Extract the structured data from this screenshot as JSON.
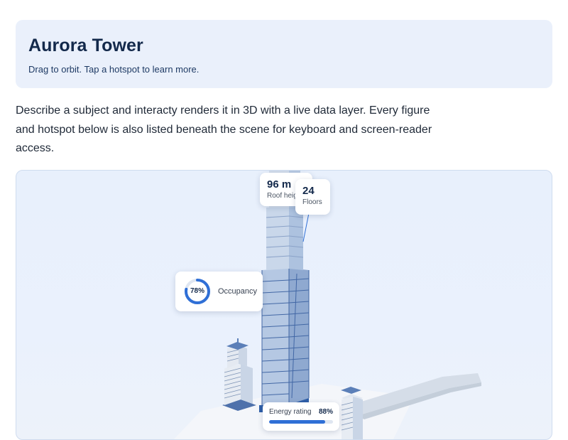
{
  "header": {
    "title": "Aurora Tower",
    "subtitle": "Drag to orbit. Tap a hotspot to learn more."
  },
  "description": "Describe a subject and interacty renders it in 3D with a live data layer. Every figure and hotspot below is also listed beneath the scene for keyboard and screen-reader access.",
  "hotspots": {
    "roof_height": {
      "value": "96 m",
      "label": "Roof height"
    },
    "floors": {
      "value": "24",
      "label": "Floors"
    },
    "occupancy": {
      "value": "78%",
      "label": "Occupancy",
      "fraction": 0.78
    },
    "energy": {
      "label": "Energy rating",
      "value": "88%",
      "fraction": 0.88
    }
  },
  "colors": {
    "accent": "#2f6fd6",
    "header_bg": "#eaf0fb",
    "title": "#13294b",
    "tower_glass": "#a9c0e0",
    "tower_roof": "#5b7fb8",
    "scene_bg": "#e8f0fc"
  }
}
